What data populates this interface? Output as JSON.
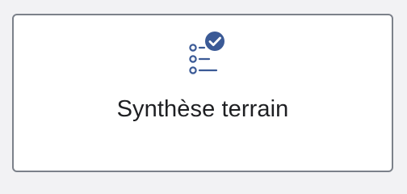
{
  "card": {
    "title": "Synthèse terrain",
    "icon": "checklist-check-icon"
  },
  "colors": {
    "background": "#f2f2f4",
    "card_background": "#ffffff",
    "card_border": "#7c818a",
    "icon": "#3b5a96",
    "text": "#1e1f22"
  }
}
